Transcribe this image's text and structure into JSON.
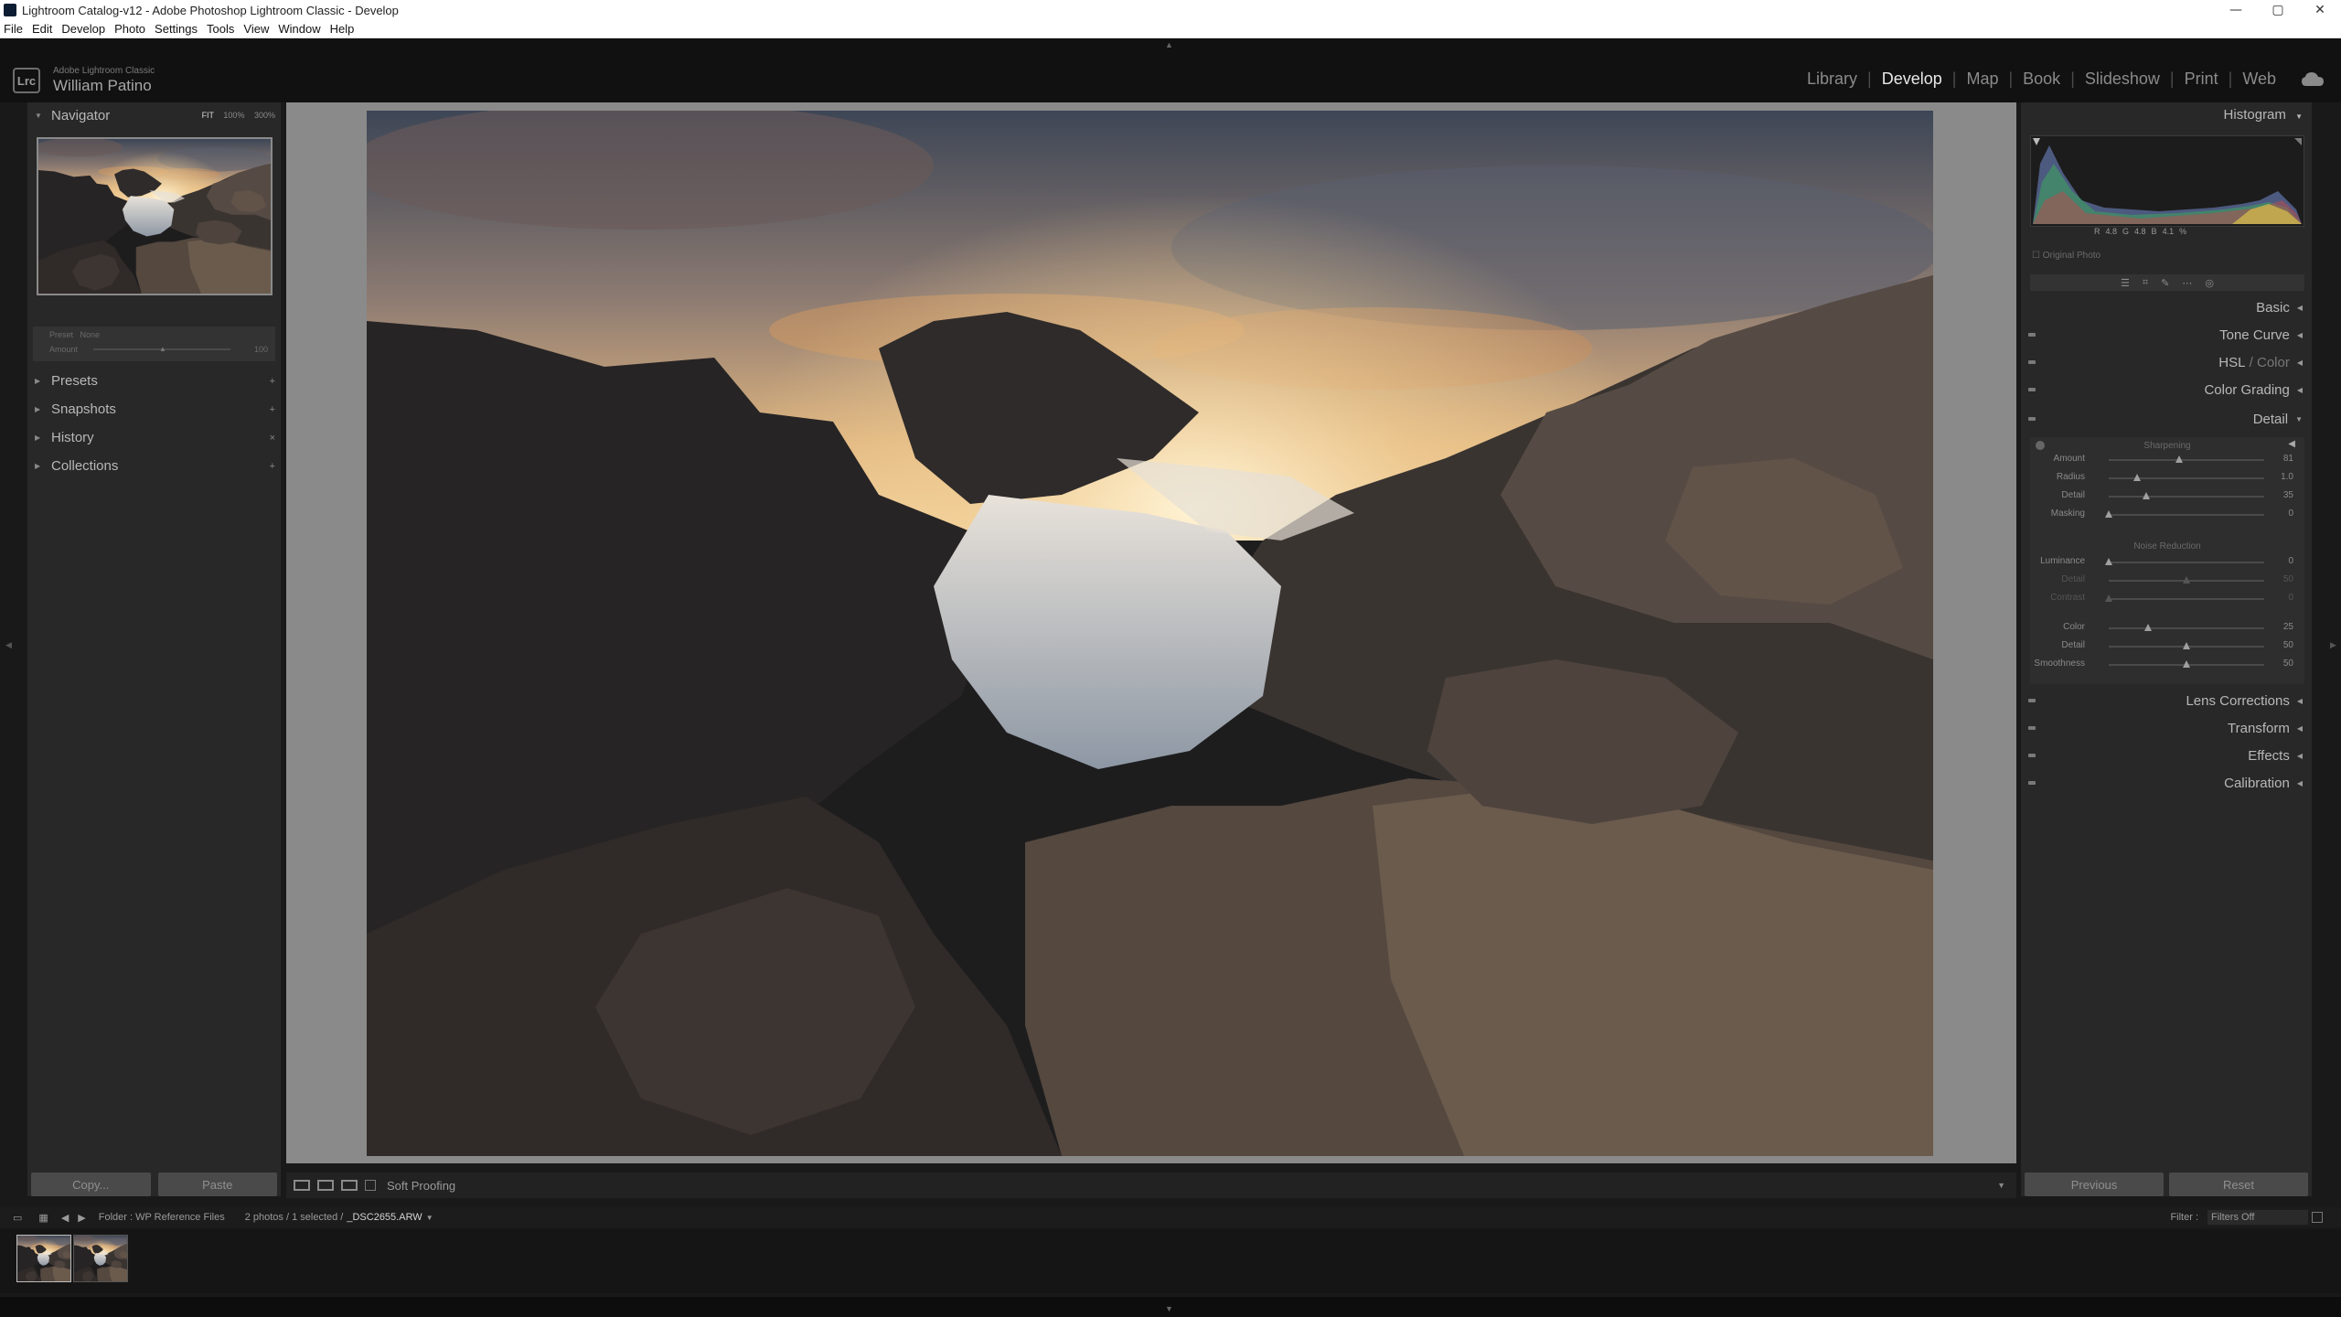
{
  "window": {
    "title": "Lightroom Catalog-v12 - Adobe Photoshop Lightroom Classic - Develop",
    "minimize": "—",
    "maximize": "▢",
    "close": "✕"
  },
  "menu": [
    "File",
    "Edit",
    "Develop",
    "Photo",
    "Settings",
    "Tools",
    "View",
    "Window",
    "Help"
  ],
  "identity": {
    "logo": "Lrc",
    "small": "Adobe Lightroom Classic",
    "user": "William Patino"
  },
  "modules": [
    "Library",
    "Develop",
    "Map",
    "Book",
    "Slideshow",
    "Print",
    "Web"
  ],
  "active_module": "Develop",
  "left_panel": {
    "navigator": {
      "label": "Navigator",
      "zooms": [
        "FIT",
        "100%",
        "300%"
      ],
      "selected_zoom": "FIT"
    },
    "preset_box": {
      "preset_label": "Preset",
      "preset_value": "None",
      "amount_label": "Amount",
      "amount_value": "100"
    },
    "sections": [
      "Presets",
      "Snapshots",
      "History",
      "Collections"
    ],
    "copy_label": "Copy...",
    "paste_label": "Paste"
  },
  "toolbar": {
    "soft_proofing": "Soft Proofing"
  },
  "right_panel": {
    "histogram_label": "Histogram",
    "readout": [
      "R",
      "4.8",
      "G",
      "4.8",
      "B",
      "4.1",
      "%"
    ],
    "original_photo": "Original Photo",
    "sections": {
      "basic": "Basic",
      "tone_curve": "Tone Curve",
      "hsl": "HSL",
      "hsl_sep": "/",
      "color": "Color",
      "color_grading": "Color Grading",
      "detail": "Detail",
      "lens_corrections": "Lens Corrections",
      "transform": "Transform",
      "effects": "Effects",
      "calibration": "Calibration"
    },
    "sharpening": {
      "title": "Sharpening",
      "rows": [
        {
          "label": "Amount",
          "value": "81",
          "pct": 0.45
        },
        {
          "label": "Radius",
          "value": "1.0",
          "pct": 0.18
        },
        {
          "label": "Detail",
          "value": "35",
          "pct": 0.24
        },
        {
          "label": "Masking",
          "value": "0",
          "pct": 0.0
        }
      ]
    },
    "noise_reduction": {
      "title": "Noise Reduction",
      "rows": [
        {
          "label": "Luminance",
          "value": "0",
          "pct": 0.0,
          "dim": false
        },
        {
          "label": "Detail",
          "value": "50",
          "pct": 0.5,
          "dim": true
        },
        {
          "label": "Contrast",
          "value": "0",
          "pct": 0.0,
          "dim": true
        },
        {
          "label": "Color",
          "value": "25",
          "pct": 0.25,
          "dim": false
        },
        {
          "label": "Detail",
          "value": "50",
          "pct": 0.5,
          "dim": false
        },
        {
          "label": "Smoothness",
          "value": "50",
          "pct": 0.5,
          "dim": false
        }
      ]
    },
    "previous_label": "Previous",
    "reset_label": "Reset"
  },
  "filmstrip": {
    "folder": "Folder : WP Reference Files",
    "selection": "2 photos / 1 selected /",
    "filename": "_DSC2655.ARW",
    "filter_label": "Filter :",
    "filter_value": "Filters Off"
  },
  "colors": {
    "background": "#191919",
    "panel": "#282828",
    "center": "#8a8a8a",
    "active_text": "#e8e8e8"
  }
}
